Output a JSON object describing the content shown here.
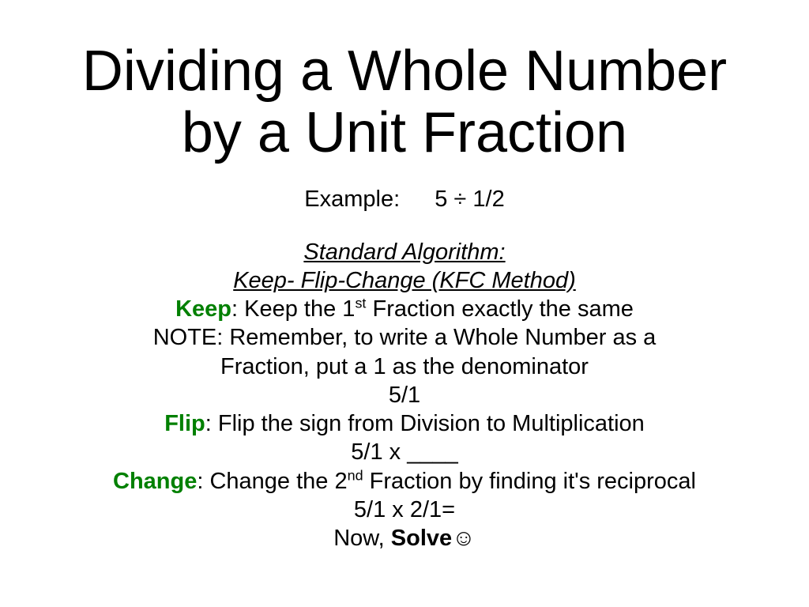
{
  "title_line1": "Dividing a Whole Number",
  "title_line2": "by a Unit Fraction",
  "example_label": "Example:",
  "example_expr": "5  ÷ 1/2",
  "algo_head1": "Standard Algorithm:",
  "algo_head2": "Keep- Flip-Change (KFC Method)",
  "keep_kw": "Keep",
  "keep_colon": ": ",
  "keep_text_a": "Keep the 1",
  "keep_ord": "st",
  "keep_text_b": " Fraction exactly the same",
  "note_line1": "NOTE: Remember, to write a Whole Number as a",
  "note_line2": "Fraction, put a 1 as the denominator",
  "frac_5_1": "5/1",
  "flip_kw": "Flip",
  "flip_text": ": Flip the sign from Division to Multiplication",
  "flip_expr": "5/1 x ____",
  "change_kw": "Change",
  "change_text_a": ": Change the 2",
  "change_ord": "nd",
  "change_text_b": " Fraction by finding it's reciprocal",
  "change_expr": "5/1  x  2/1=",
  "now_text": "Now, ",
  "solve_text": "Solve",
  "smiley": "☺"
}
